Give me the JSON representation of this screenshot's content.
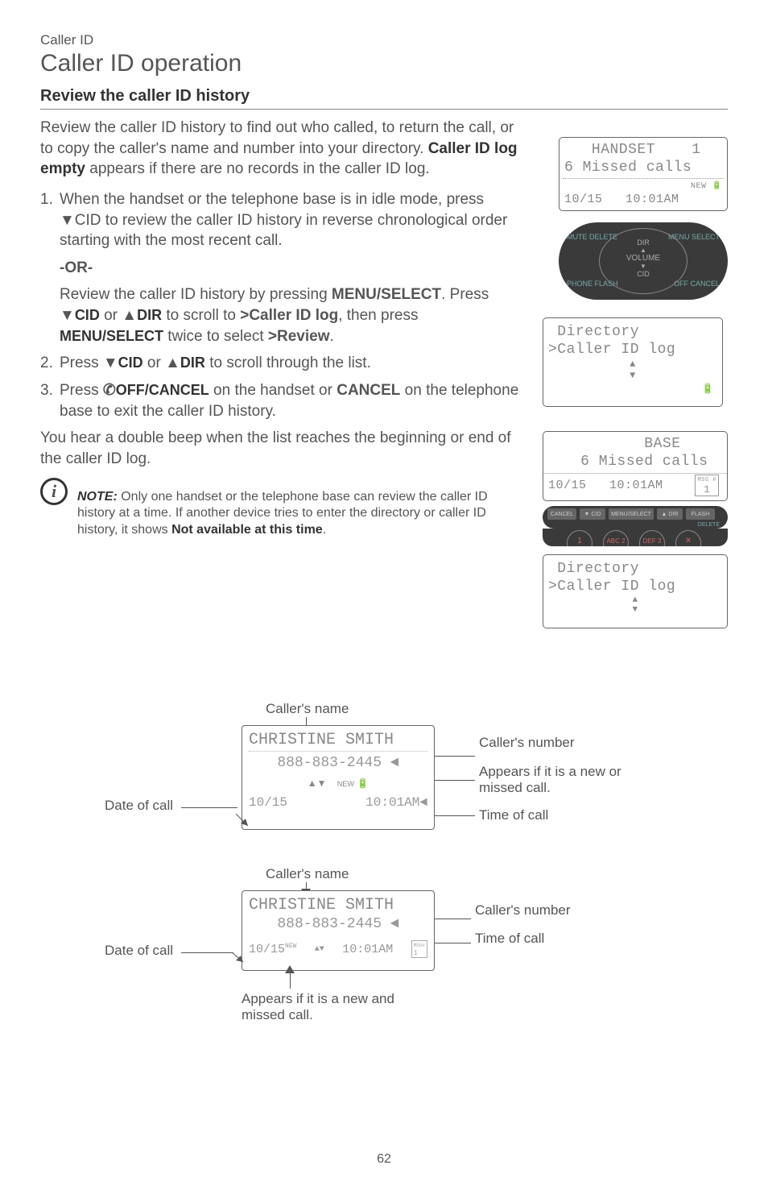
{
  "breadcrumb": "Caller ID",
  "page_title": "Caller ID operation",
  "section_heading": "Review the caller ID history",
  "intro": {
    "pre": "Review the caller ID history to find out who called, to return the call, or to copy the caller's name and number into your directory. ",
    "bold": "Caller ID log empty",
    "post": " appears if there are no records in the caller ID log."
  },
  "step1": {
    "num": "1.",
    "text": "When the handset or the telephone base is in idle mode, press ▼CID to review the caller ID history in reverse chronological order starting with the most recent call.",
    "or": "-OR-",
    "cont_pre": "Review the caller ID history by pressing ",
    "menu_select1": "MENU/SELECT",
    "cont_mid1": ". Press ▼",
    "cid": "CID",
    "cont_mid2": " or ▲",
    "dir": "DIR",
    "cont_mid3": " to scroll to ",
    "target": ">Caller ID log",
    "cont_mid4": ", then press ",
    "menu_select2": "MENU/SELECT",
    "cont_mid5": " twice to select ",
    "review": ">Review",
    "cont_end": "."
  },
  "step2": {
    "num": "2.",
    "pre": "Press ▼",
    "cid": "CID",
    "mid": " or ▲",
    "dir": "DIR",
    "post": " to scroll through the list."
  },
  "step3": {
    "num": "3.",
    "pre": "Press ",
    "off_cancel": "OFF/CANCEL",
    "mid": " on the handset or ",
    "cancel": "CANCEL",
    "post": " on the telephone base to exit the caller ID history."
  },
  "beep_text": "You hear a double beep when the list reaches the beginning or end of the caller ID log.",
  "note": {
    "label": "NOTE:",
    "text": " Only one handset or the telephone base can review the caller ID history at a time. If another device tries to enter the directory or caller ID history, it shows ",
    "bold_end": "Not available at this time",
    "period": "."
  },
  "handset_lcd": {
    "line1": "   HANDSET    1",
    "line2": "6 Missed calls",
    "new": "NEW",
    "line3": "10/15   10:01AM"
  },
  "phone_keys": {
    "dir": "DIR",
    "volume": "VOLUME",
    "cid": "CID",
    "mute": "MUTE\nDELETE",
    "menu": "MENU\nSELECT",
    "phone": "PHONE\nFLASH",
    "off": "OFF\nCANCEL"
  },
  "menu_lcd1": {
    "line1": " Directory",
    "line2": ">Caller ID log"
  },
  "base_lcd": {
    "line1": "      BASE",
    "line2": "  6 Missed calls",
    "line3": "10/15   10:01AM",
    "msg_label": "MSG #",
    "msg_num": "1"
  },
  "base_buttons": {
    "cancel": "CANCEL",
    "vcid": "▼ CID",
    "menu": "MENU/SELECT",
    "adir": "▲ DIR",
    "flash": "FLASH",
    "delete": "DELETE"
  },
  "menu_lcd2": {
    "line1": " Directory",
    "line2": ">Caller ID log"
  },
  "diagram1": {
    "name_label": "Caller's name",
    "name": "CHRISTINE SMITH",
    "number": "888-883-2445",
    "number_label": "Caller's number",
    "new": "NEW",
    "new_label": "Appears if it is a new or missed call.",
    "date": "10/15",
    "date_label": "Date of call",
    "time": "10:01AM",
    "time_label": "Time of call"
  },
  "diagram2": {
    "name_label": "Caller's name",
    "name": "CHRISTINE SMITH",
    "number": "888-883-2445",
    "number_label": "Caller's number",
    "date": "10/15",
    "new": "NEW",
    "time": "10:01AM",
    "msg_num": "1",
    "date_label": "Date of call",
    "time_label": "Time of call",
    "new_label": "Appears if it is a new and missed call."
  },
  "page_number": "62"
}
